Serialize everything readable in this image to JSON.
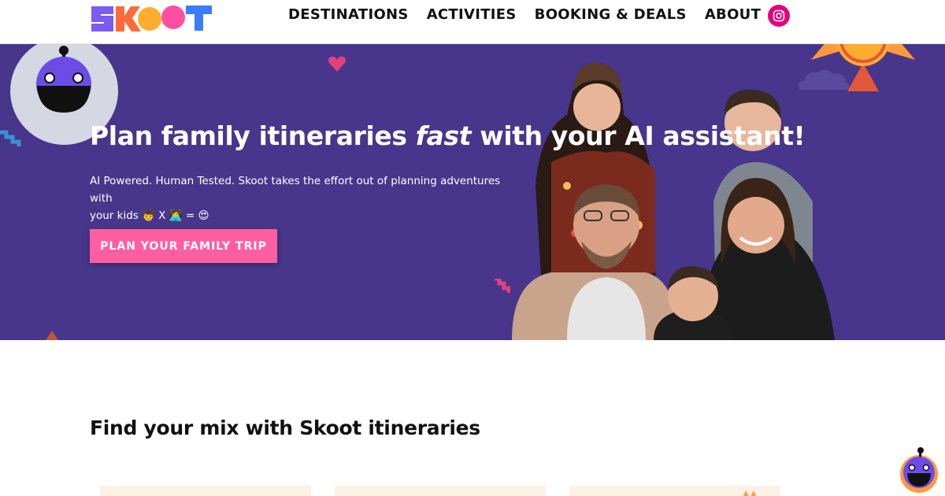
{
  "header": {
    "logo": "SKOOT",
    "nav": [
      {
        "label": "DESTINATIONS"
      },
      {
        "label": "ACTIVITIES"
      },
      {
        "label": "BOOKING & DEALS"
      },
      {
        "label": "ABOUT"
      }
    ],
    "instagram_icon": "instagram-icon"
  },
  "hero": {
    "title_before": "Plan family itineraries ",
    "title_emphasis": "fast",
    "title_after": " with your AI assistant!",
    "subtitle_line1": "AI Powered. Human Tested. Skoot takes the effort out of planning adventures with",
    "subtitle_line2": "your kids 👦 X 👩‍💻 = 😍",
    "cta_label": "PLAN YOUR FAMILY TRIP"
  },
  "section": {
    "title": "Find your mix with Skoot itineraries"
  },
  "colors": {
    "hero_bg": "#47368b",
    "cta": "#ff5fa0",
    "instagram": "#e4007a",
    "card_bg": "#fdf1e6",
    "logo_purple": "#7b5cf0",
    "logo_orange": "#ff6a3d",
    "logo_yellow": "#ffad2e",
    "logo_pink": "#ff4fa3",
    "logo_blue": "#3d7bff"
  }
}
